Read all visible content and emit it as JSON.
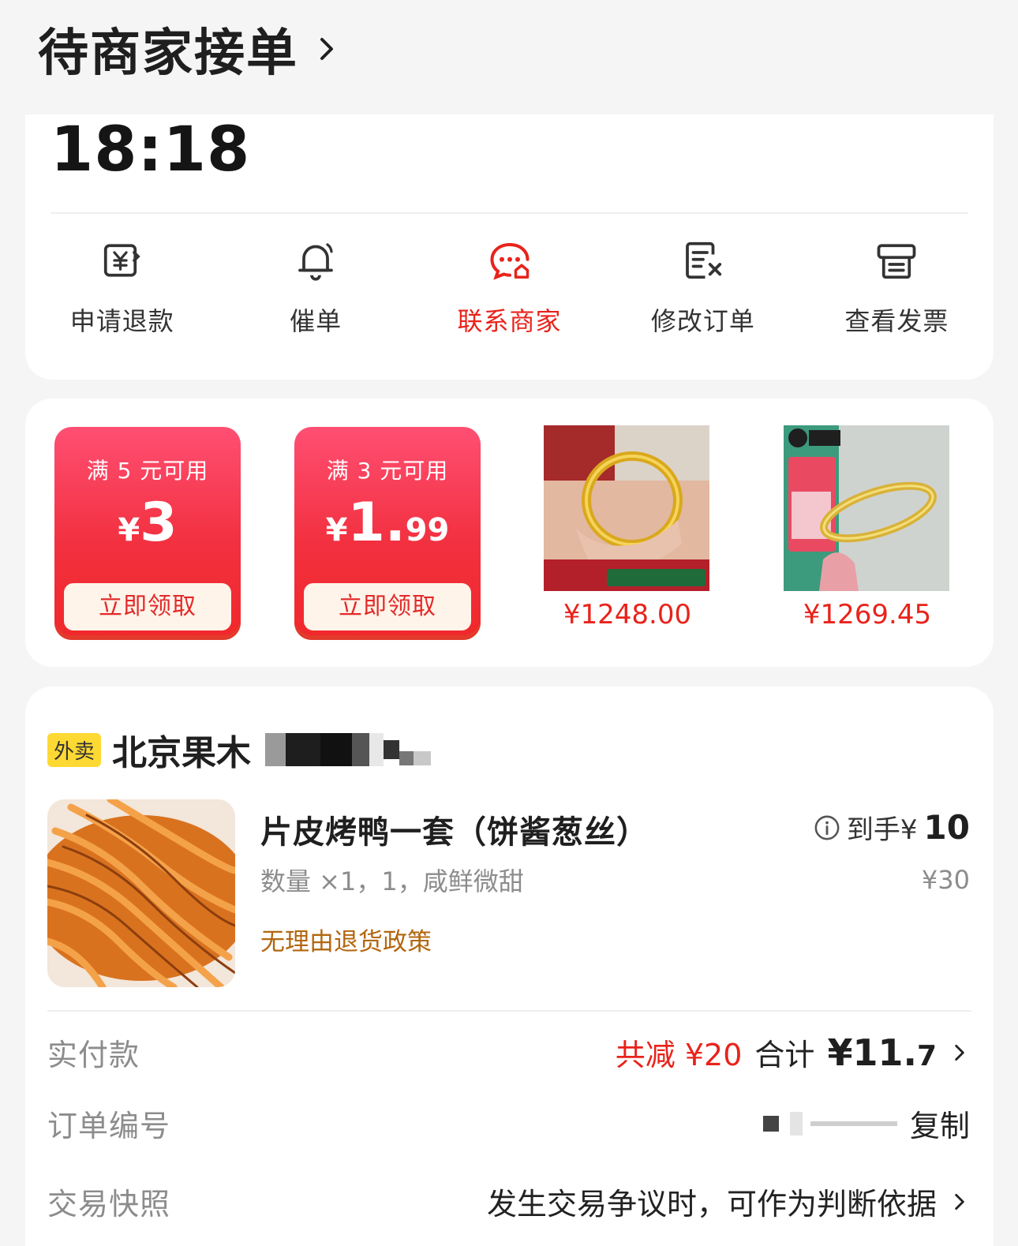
{
  "header": {
    "title": "待商家接单"
  },
  "card_actions": {
    "time": "18:18",
    "actions": [
      {
        "label": "申请退款",
        "icon": "refund-icon"
      },
      {
        "label": "催单",
        "icon": "bell-icon"
      },
      {
        "label": "联系商家",
        "icon": "chat-icon",
        "active": true
      },
      {
        "label": "修改订单",
        "icon": "edit-order-icon"
      },
      {
        "label": "查看发票",
        "icon": "invoice-icon"
      }
    ]
  },
  "promo": {
    "coupons": [
      {
        "condition": "满 5 元可用",
        "currency": "¥",
        "amount_int": "3",
        "amount_dec": "",
        "button": "立即领取"
      },
      {
        "condition": "满 3 元可用",
        "currency": "¥",
        "amount_int": "1.",
        "amount_dec": "99",
        "button": "立即领取"
      }
    ],
    "products": [
      {
        "price": "¥1248.00"
      },
      {
        "price": "¥1269.45"
      }
    ]
  },
  "order": {
    "tag": "外卖",
    "shop_name": "北京果木",
    "item": {
      "name": "片皮烤鸭一套（饼酱葱丝）",
      "spec": "数量 ×1，1，咸鲜微甜",
      "policy": "无理由退货政策",
      "price_prefix": "到手¥",
      "price_final": "10",
      "price_original": "¥30"
    },
    "payment": {
      "label": "实付款",
      "discount": "共减 ¥20",
      "total_label": "合计",
      "total_int": "¥11.",
      "total_dec": "7"
    },
    "order_no": {
      "label": "订单编号",
      "copy": "复制"
    },
    "snapshot": {
      "label": "交易快照",
      "text": "发生交易争议时，可作为判断依据"
    },
    "colors": {
      "accent": "#e8231b",
      "tag_bg": "#ffd933",
      "policy": "#b2670f"
    }
  }
}
